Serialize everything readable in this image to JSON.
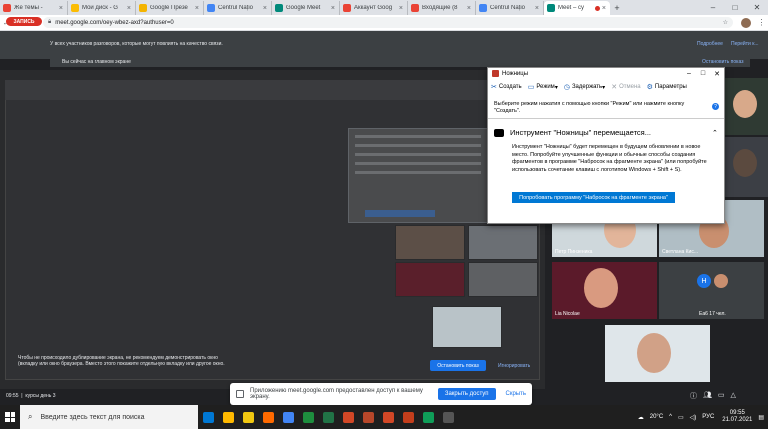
{
  "tabs": [
    {
      "label": "Же темы - ",
      "favicon_color": "#ea4335"
    },
    {
      "label": "Мой диск - G",
      "favicon_color": "#fbbc04"
    },
    {
      "label": "Google Презе",
      "favicon_color": "#f4b400"
    },
    {
      "label": "Centrul Națio",
      "favicon_color": "#4285f4"
    },
    {
      "label": "Google Meet",
      "favicon_color": "#00897b"
    },
    {
      "label": "Аккаунт Goog",
      "favicon_color": "#ea4335"
    },
    {
      "label": "Входящие (8",
      "favicon_color": "#ea4335"
    },
    {
      "label": "Centrul Națio",
      "favicon_color": "#4285f4"
    },
    {
      "label": "Meet – су",
      "favicon_color": "#00897b",
      "active": true
    }
  ],
  "address": {
    "url": "meet.google.com/oey-wbez-axd?authuser=0"
  },
  "banner": {
    "record": "ЗАПИСЬ",
    "text": "У всех участников разговоров, которые могут повлиять на качество связи.",
    "link1": "Подробнее",
    "link2": "Перейти к...",
    "row2": "Вы сейчас на главном экране",
    "row2_right": "Остановить показ"
  },
  "presenting": {
    "text": "Чтобы не происходило дублирование экрана, не рекомендуем демонстрировать окно (вкладку или окно браузера. Вместо этого покажите отдельную вкладку или другое окно.",
    "button": "Остановить показ",
    "link": "Игнорировать"
  },
  "participants": [
    {
      "name": "",
      "bg": "#2f3a33",
      "face": "#d8a98a"
    },
    {
      "name": "",
      "bg": "#3c3f45",
      "face": "#5b4a3f"
    },
    {
      "name": "Петр Пинзеника",
      "bg": "#cfd8dc",
      "face": "#e2b59a"
    },
    {
      "name": "Светлана Кис...",
      "bg": "#b0bec5",
      "face": "#c98f6f"
    },
    {
      "name": "Lia Nicolae",
      "bg": "#5b1a2a",
      "face": "#d99a80"
    },
    {
      "name": "Ea6 17 чел.",
      "bg": "#3c4043",
      "face": "#1a73e8",
      "avatar_letter": "Н"
    },
    {
      "name": "",
      "bg": "#dfe6ea",
      "face": "#d1a187"
    }
  ],
  "meetbar": {
    "time": "09:55",
    "title": "курсы день 3"
  },
  "notice": {
    "text": "Приложению meet.google.com предоставлен доступ к вашему экрану.",
    "button": "Закрыть доступ",
    "hide": "Скрыть"
  },
  "snip": {
    "title": "Ножницы",
    "toolbar": [
      {
        "label": "Создать",
        "icon": "scissors-icon",
        "disabled": false
      },
      {
        "label": "Режим",
        "icon": "mode-icon",
        "disabled": false
      },
      {
        "label": "Задержать",
        "icon": "clock-icon",
        "disabled": false
      },
      {
        "label": "Отмена",
        "icon": "cancel-icon",
        "disabled": true
      },
      {
        "label": "Параметры",
        "icon": "gear-icon",
        "disabled": false
      }
    ],
    "hint": "Выберите режим нажатия с помощью кнопки \"Режим\" или нажмите кнопку \"Создать\".",
    "heading": "Инструмент \"Ножницы\" перемещается...",
    "body": "Инструмент \"Ножницы\" будет перемещен в будущем обновлении в новое место. Попробуйте улучшенные функции и обычные способы создания фрагментов в программе \"Набросок на фрагменте экрана\" (или попробуйте использовать сочетание клавиш с логотипом Windows + Shift + S).",
    "button": "Попробовать программу \"Набросок на фрагменте экрана\""
  },
  "taskbar": {
    "search_placeholder": "Введите здесь текст для поиска",
    "apps": [
      "#0078d4",
      "#ffb900",
      "#f2c811",
      "#ff6a00",
      "#4285f4",
      "#1e8e3e",
      "#217346",
      "#d24726",
      "#b7472a",
      "#d24726",
      "#c43e1c",
      "#0f9d58",
      "#555555"
    ],
    "temp": "20°C",
    "lang": "РУС",
    "time": "09:55",
    "date": "21.07.2021"
  }
}
